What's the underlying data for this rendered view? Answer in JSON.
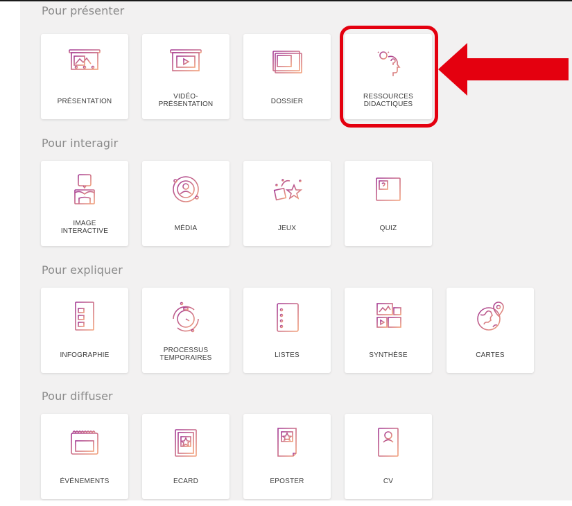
{
  "sections": [
    {
      "title": "Pour présenter",
      "tiles": [
        {
          "label": "PRÉSENTATION",
          "icon": "presentation-board-icon"
        },
        {
          "label": "VIDÉO-\nPRÉSENTATION",
          "icon": "video-presentation-icon"
        },
        {
          "label": "DOSSIER",
          "icon": "dossier-folder-icon"
        },
        {
          "label": "RESSOURCES\nDIDACTIQUES",
          "icon": "lightbulb-head-icon"
        }
      ]
    },
    {
      "title": "Pour interagir",
      "tiles": [
        {
          "label": "IMAGE\nINTERACTIVE",
          "icon": "interactive-image-icon"
        },
        {
          "label": "MÉDIA",
          "icon": "media-orbit-icon"
        },
        {
          "label": "JEUX",
          "icon": "games-puzzle-star-icon"
        },
        {
          "label": "QUIZ",
          "icon": "quiz-board-icon"
        }
      ]
    },
    {
      "title": "Pour expliquer",
      "tiles": [
        {
          "label": "INFOGRAPHIE",
          "icon": "infographic-icon"
        },
        {
          "label": "PROCESSUS\nTEMPORAIRES",
          "icon": "timer-process-icon"
        },
        {
          "label": "LISTES",
          "icon": "checklist-icon"
        },
        {
          "label": "SYNTHÈSE",
          "icon": "synthesis-screens-icon"
        },
        {
          "label": "CARTES",
          "icon": "globe-pin-icon"
        }
      ]
    },
    {
      "title": "Pour diffuser",
      "tiles": [
        {
          "label": "ÉVÉNEMENTS",
          "icon": "calendar-icon"
        },
        {
          "label": "ECARD",
          "icon": "ecard-star-icon"
        },
        {
          "label": "EPOSTER",
          "icon": "eposter-star-icon"
        },
        {
          "label": "CV",
          "icon": "cv-profile-icon"
        }
      ]
    }
  ],
  "colors": {
    "icon_gradient_start": "#a43a94",
    "icon_gradient_end": "#f2a27c",
    "highlight": "#e4000f",
    "background": "#f2f1f1"
  }
}
